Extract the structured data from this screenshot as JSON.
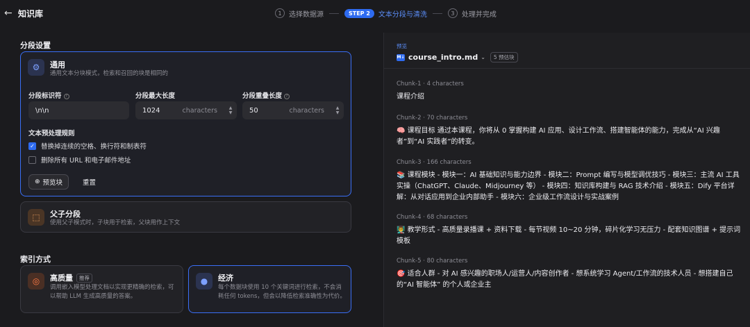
{
  "header": {
    "back_icon": "arrow-left-icon",
    "title": "知识库",
    "steps": [
      {
        "num": "1",
        "label": "选择数据源"
      },
      {
        "pill": "STEP 2",
        "label": "文本分段与清洗"
      },
      {
        "num": "3",
        "label": "处理并完成"
      }
    ]
  },
  "segment": {
    "section_title": "分段设置",
    "general": {
      "icon": "gear-icon",
      "title": "通用",
      "desc": "通用文本分块模式，检索和召回的块是相同的",
      "separator_label": "分段标识符",
      "separator_value": "\\n\\n",
      "maxlen_label": "分段最大长度",
      "maxlen_value": "1024",
      "maxlen_unit": "characters",
      "overlap_label": "分段重叠长度",
      "overlap_value": "50",
      "overlap_unit": "characters",
      "rules_title": "文本预处理规则",
      "rule1": "替换掉连续的空格、换行符和制表符",
      "rule1_checked": true,
      "rule2": "删除所有 URL 和电子邮件地址",
      "rule2_checked": false,
      "preview_btn": "预览块",
      "reset_btn": "重置"
    },
    "parent_child": {
      "icon": "parent-child-icon",
      "title": "父子分段",
      "desc": "使用父子模式时，子块用于检索，父块用作上下文"
    }
  },
  "index": {
    "section_title": "索引方式",
    "high": {
      "icon": "target-icon",
      "title": "高质量",
      "badge": "推荐",
      "desc": "调用嵌入模型处理文档以实现更精确的检索，可以帮助 LLM 生成高质量的答案。"
    },
    "eco": {
      "icon": "coins-icon",
      "title": "经济",
      "desc": "每个数据块使用 10 个关键词进行检索，不会消耗任何 tokens，但会以降低检索准确性为代价。"
    }
  },
  "preview": {
    "label": "预览",
    "file_icon": "markdown-file-icon",
    "file_name": "course_intro.md",
    "badge": "5 预估块",
    "chunks": [
      {
        "head": "Chunk-1 · 4 characters",
        "text": "课程介绍"
      },
      {
        "head": "Chunk-2 · 70 characters",
        "text": "🧠 课程目标 通过本课程，你将从 0 掌握构建 AI 应用、设计工作流、搭建智能体的能力，完成从“AI 兴趣者”到“AI 实践者”的转变。"
      },
      {
        "head": "Chunk-3 · 166 characters",
        "text": "📚 课程模块 - 模块一：AI 基础知识与能力边界 - 模块二：Prompt 编写与模型调优技巧 - 模块三：主流 AI 工具实操（ChatGPT、Claude、Midjourney 等） - 模块四：知识库构建与 RAG 技术介绍 - 模块五：Dify 平台详解：从对话应用到企业内部助手 - 模块六：企业级工作流设计与实战案例"
      },
      {
        "head": "Chunk-4 · 68 characters",
        "text": "👨‍🏫 教学形式 - 高质量录播课 + 资料下载 - 每节视频 10~20 分钟，碎片化学习无压力 - 配套知识图谱 + 提示词模板"
      },
      {
        "head": "Chunk-5 · 80 characters",
        "text": "🎯 适合人群 - 对 AI 感兴趣的职场人/运营人/内容创作者 - 想系统学习 Agent/工作流的技术人员 - 想搭建自己的“AI 智能体” 的个人或企业主"
      }
    ]
  }
}
